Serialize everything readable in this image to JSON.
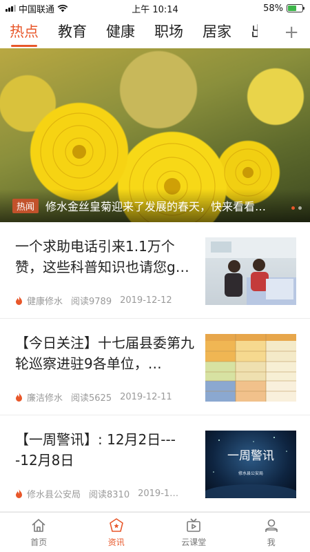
{
  "status_bar": {
    "carrier": "中国联通",
    "time": "上午 10:14",
    "battery": "58%",
    "battery_level": 0.58
  },
  "tabs": [
    {
      "label": "热点",
      "active": true
    },
    {
      "label": "教育"
    },
    {
      "label": "健康"
    },
    {
      "label": "职场"
    },
    {
      "label": "居家"
    },
    {
      "label": "出"
    }
  ],
  "tab_add": "+",
  "hero": {
    "tag": "热闻",
    "title": "修水金丝皇菊迎来了发展的春天，快来看看…"
  },
  "news": [
    {
      "title": "一个求助电话引来1.1万个赞，这些科普知识也请您g…",
      "source": "健康修水",
      "reads": "阅读9789",
      "date": "2019-12-12"
    },
    {
      "title": "【今日关注】十七届县委第九轮巡察进驻9各单位，…",
      "source": "廉洁修水",
      "reads": "阅读5625",
      "date": "2019-12-11"
    },
    {
      "title": "【一周警讯】: 12月2日----12月8日",
      "source": "修水县公安局",
      "reads": "阅读8310",
      "date": "2019-1…",
      "thumb_text": "一周警讯",
      "thumb_sub": "修水县公安局"
    }
  ],
  "bottom_nav": [
    {
      "label": "首页",
      "icon": "home-icon"
    },
    {
      "label": "资讯",
      "icon": "news-badge-icon",
      "active": true
    },
    {
      "label": "云课堂",
      "icon": "tv-icon"
    },
    {
      "label": "我",
      "icon": "user-icon"
    }
  ],
  "colors": {
    "accent": "#e8572a",
    "text": "#222222",
    "meta": "#9a9a9a"
  }
}
